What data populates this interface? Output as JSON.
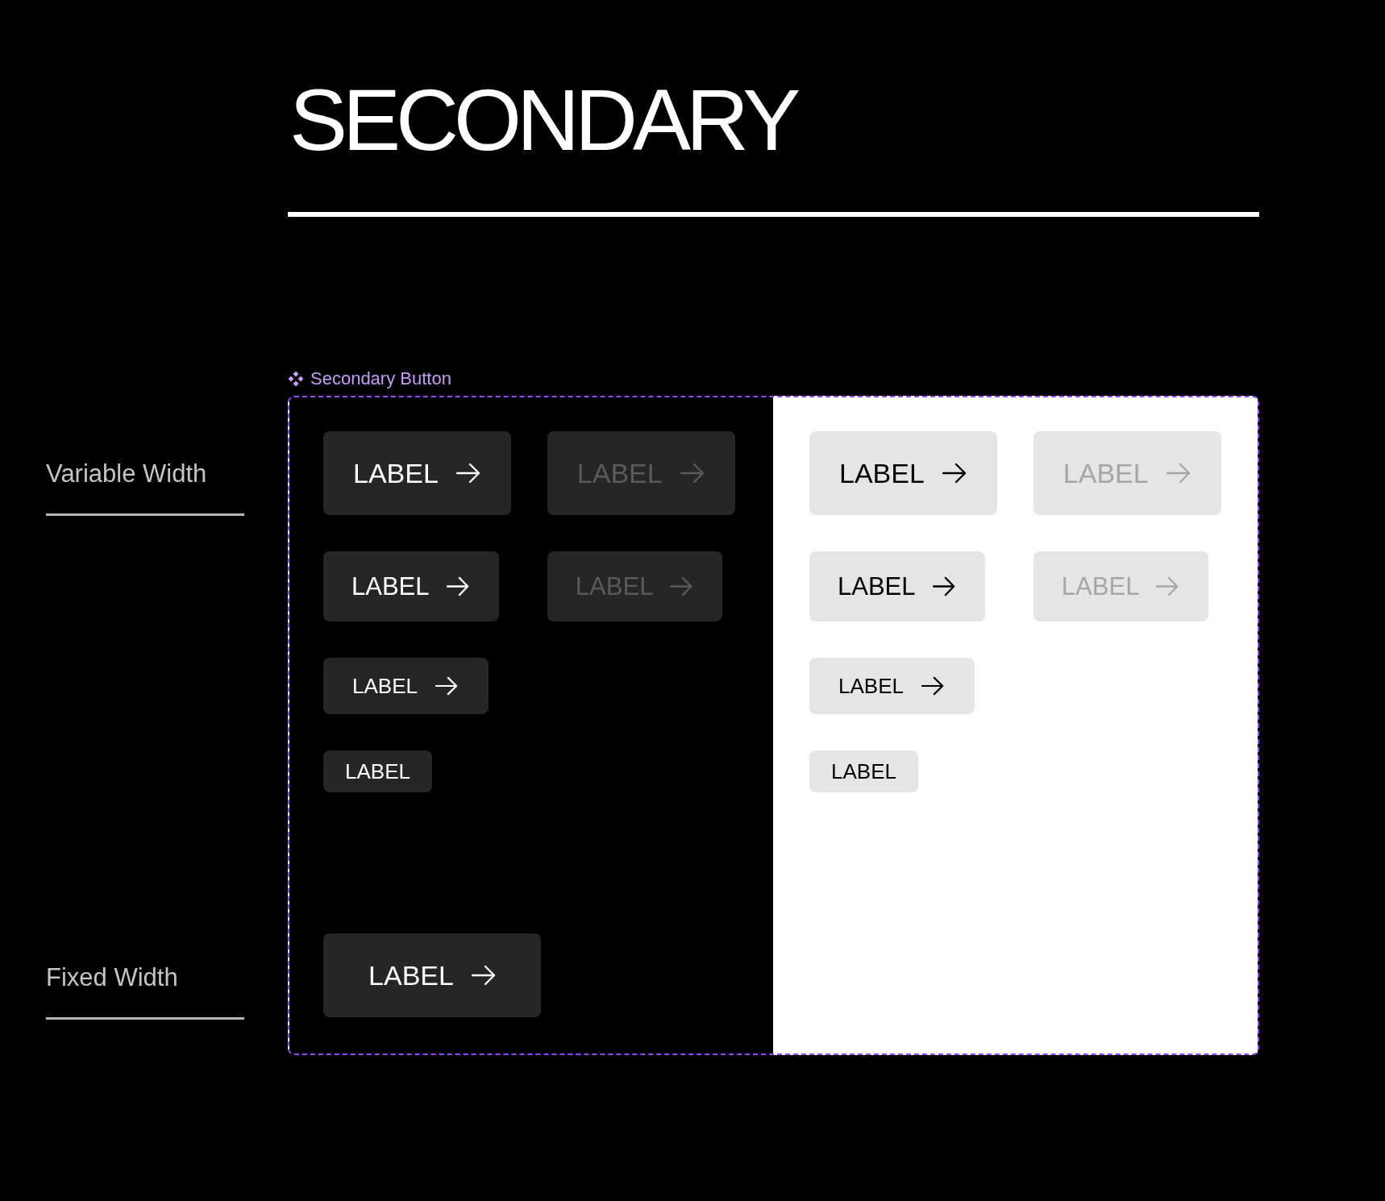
{
  "title": "SECONDARY",
  "sections": [
    {
      "label": "Variable Width"
    },
    {
      "label": "Fixed Width"
    }
  ],
  "component": {
    "name": "Secondary Button",
    "panels": [
      {
        "kind": "dark",
        "variable_width": [
          {
            "buttons": [
              {
                "label": "LABEL",
                "kind": "large",
                "arrow": true,
                "disabled": false
              },
              {
                "label": "LABEL",
                "kind": "large",
                "arrow": true,
                "disabled": true
              }
            ]
          },
          {
            "buttons": [
              {
                "label": "LABEL",
                "kind": "medium",
                "arrow": true,
                "disabled": false
              },
              {
                "label": "LABEL",
                "kind": "medium",
                "arrow": true,
                "disabled": true
              }
            ]
          },
          {
            "buttons": [
              {
                "label": "LABEL",
                "kind": "small",
                "arrow": true,
                "disabled": false
              }
            ]
          },
          {
            "buttons": [
              {
                "label": "LABEL",
                "kind": "xsmall",
                "arrow": false,
                "disabled": false
              }
            ]
          }
        ],
        "fixed_width": [
          {
            "label": "LABEL",
            "kind": "large",
            "arrow": true,
            "disabled": false
          }
        ]
      },
      {
        "kind": "light",
        "variable_width": [
          {
            "buttons": [
              {
                "label": "LABEL",
                "kind": "large",
                "arrow": true,
                "disabled": false
              },
              {
                "label": "LABEL",
                "kind": "large",
                "arrow": true,
                "disabled": true
              }
            ]
          },
          {
            "buttons": [
              {
                "label": "LABEL",
                "kind": "medium",
                "arrow": true,
                "disabled": false
              },
              {
                "label": "LABEL",
                "kind": "medium",
                "arrow": true,
                "disabled": true
              }
            ]
          },
          {
            "buttons": [
              {
                "label": "LABEL",
                "kind": "small",
                "arrow": true,
                "disabled": false
              }
            ]
          },
          {
            "buttons": [
              {
                "label": "LABEL",
                "kind": "xsmall",
                "arrow": false,
                "disabled": false
              }
            ]
          }
        ]
      }
    ]
  }
}
